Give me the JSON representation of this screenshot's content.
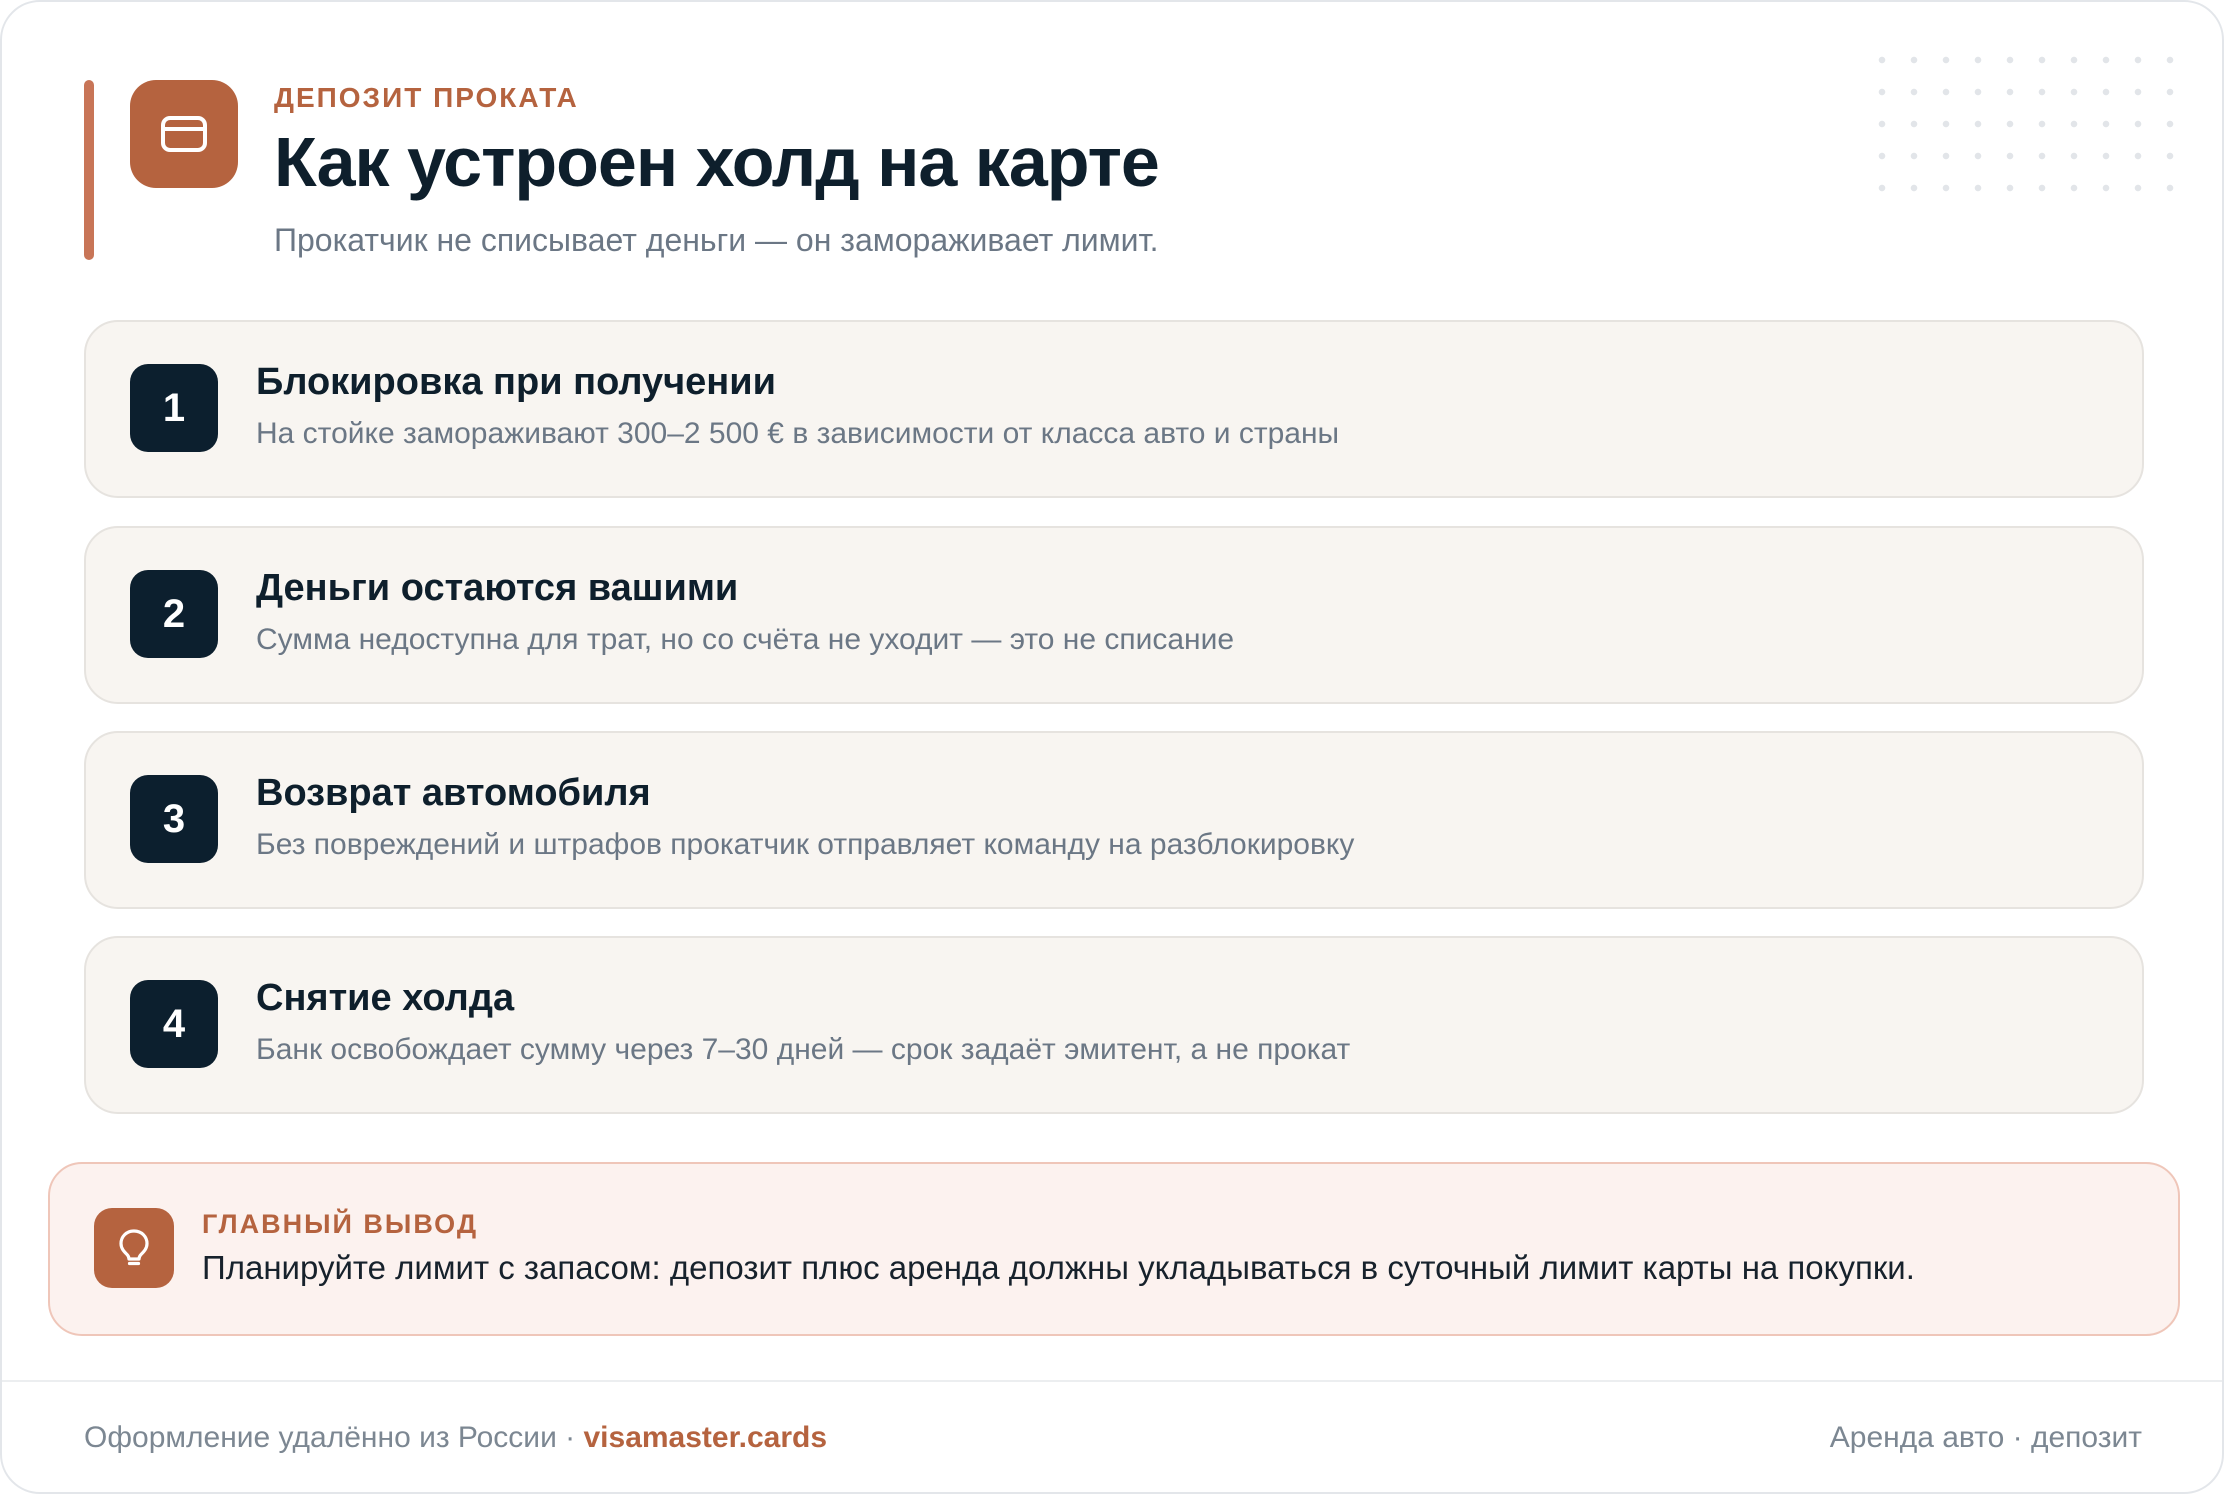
{
  "header": {
    "eyebrow": "ДЕПОЗИТ ПРОКАТА",
    "title": "Как устроен холд на карте",
    "subtitle": "Прокатчик не списывает деньги — он замораживает лимит.",
    "icon": "credit-card-icon"
  },
  "steps": [
    {
      "number": "1",
      "title": "Блокировка при получении",
      "description": "На стойке замораживают 300–2 500 € в зависимости от класса авто и страны"
    },
    {
      "number": "2",
      "title": "Деньги остаются вашими",
      "description": "Сумма недоступна для трат, но со счёта не уходит — это не списание"
    },
    {
      "number": "3",
      "title": "Возврат автомобиля",
      "description": "Без повреждений и штрафов прокатчик отправляет команду на разблокировку"
    },
    {
      "number": "4",
      "title": "Снятие холда",
      "description": "Банк освобождает сумму через 7–30 дней — срок задаёт эмитент, а не прокат"
    }
  ],
  "callout": {
    "icon": "lightbulb-icon",
    "label": "ГЛАВНЫЙ ВЫВОД",
    "text": "Планируйте лимит с запасом: депозит плюс аренда должны укладываться в суточный лимит карты на покупки."
  },
  "footer": {
    "left_text": "Оформление удалённо из России · ",
    "brand": "visamaster.cards",
    "right_text": "Аренда авто · депозит"
  },
  "colors": {
    "accent": "#b5633f",
    "dark": "#0c1f2e",
    "step_background": "#f8f5f1",
    "callout_background": "#fcf2ef"
  }
}
